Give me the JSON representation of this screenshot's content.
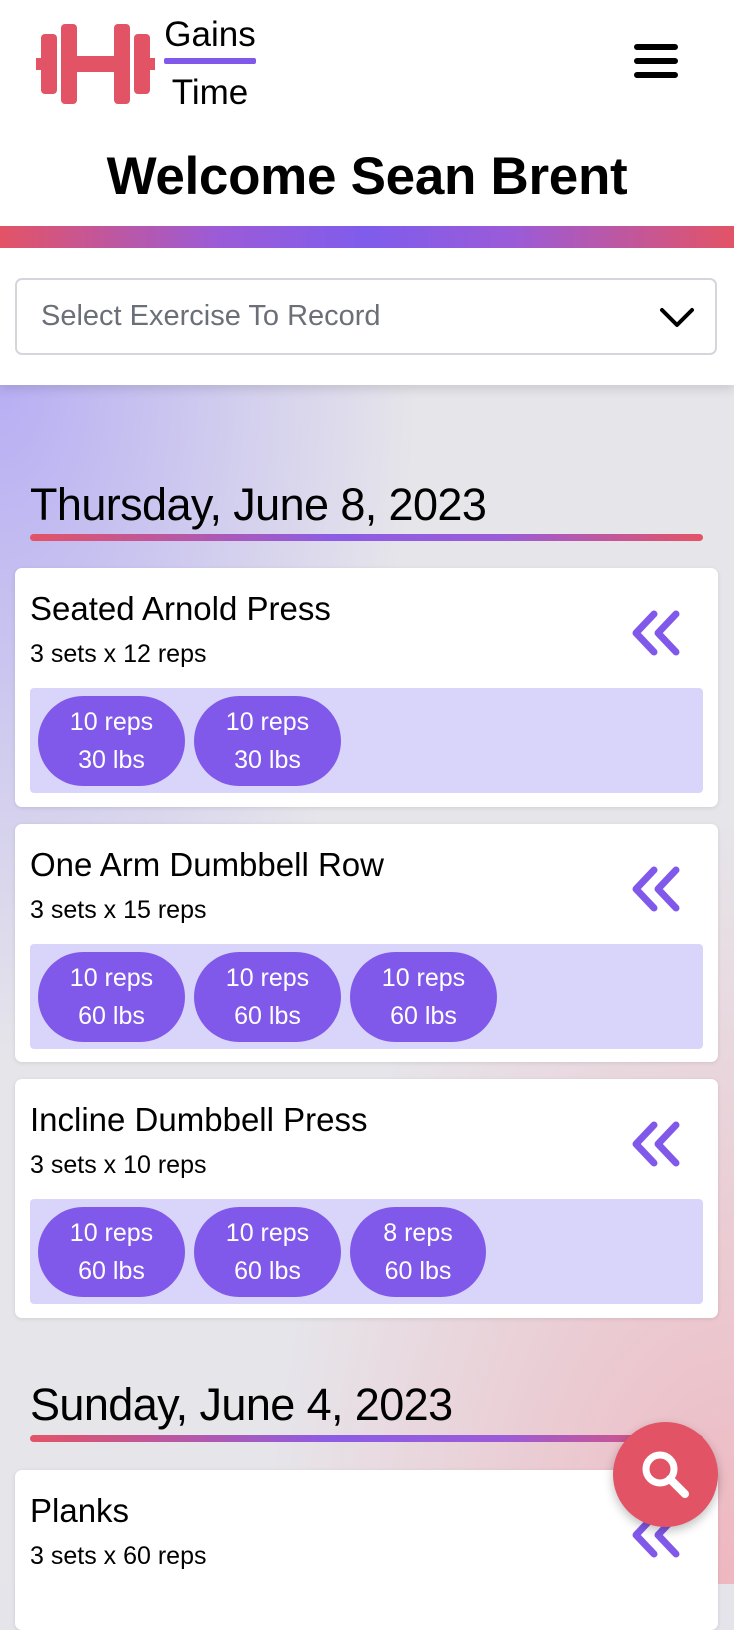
{
  "header": {
    "brand_top": "Gains",
    "brand_bottom": "Time",
    "welcome": "Welcome Sean Brent",
    "select_placeholder": "Select Exercise To Record"
  },
  "days": [
    {
      "date": "Thursday, June 8, 2023",
      "exercises": [
        {
          "name": "Seated Arnold Press",
          "target": "3 sets x 12 reps",
          "sets": [
            {
              "reps": "10 reps",
              "weight": "30 lbs"
            },
            {
              "reps": "10 reps",
              "weight": "30 lbs"
            }
          ]
        },
        {
          "name": "One Arm Dumbbell Row",
          "target": "3 sets x 15 reps",
          "sets": [
            {
              "reps": "10 reps",
              "weight": "60 lbs"
            },
            {
              "reps": "10 reps",
              "weight": "60 lbs"
            },
            {
              "reps": "10 reps",
              "weight": "60 lbs"
            }
          ]
        },
        {
          "name": "Incline Dumbbell Press",
          "target": "3 sets x 10 reps",
          "sets": [
            {
              "reps": "10 reps",
              "weight": "60 lbs"
            },
            {
              "reps": "10 reps",
              "weight": "60 lbs"
            },
            {
              "reps": "8 reps",
              "weight": "60 lbs"
            }
          ]
        }
      ]
    },
    {
      "date": "Sunday, June 4, 2023",
      "exercises": [
        {
          "name": "Planks",
          "target": "3 sets x 60 reps",
          "sets": []
        }
      ]
    }
  ],
  "icons": {
    "logo": "dumbbell-logo-icon",
    "menu": "hamburger-menu-icon",
    "select": "chevron-down-icon",
    "card_action": "double-chevron-left-icon",
    "fab": "search-icon"
  },
  "colors": {
    "accent": "#8159ea",
    "accent_light": "#d9d5fa",
    "brand_red": "#e35366"
  }
}
